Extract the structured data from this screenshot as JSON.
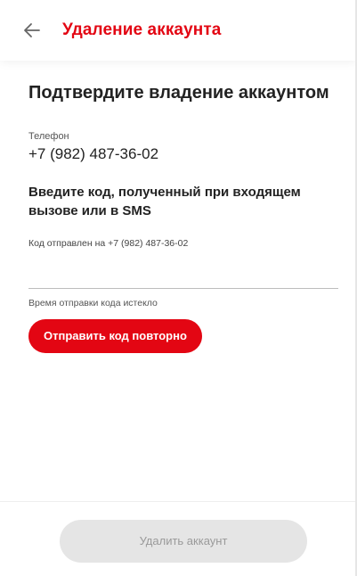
{
  "header": {
    "back_icon": "arrow-left-icon",
    "title": "Удаление аккаунта"
  },
  "main": {
    "title": "Подтвердите владение аккаунтом",
    "phone_label": "Телефон",
    "phone_value": "+7 (982) 487-36-02",
    "instruction": "Введите код, полученный при входящем вызове или в SMS",
    "sent_note": "Код отправлен на +7 (982) 487-36-02",
    "code_value": "",
    "expired_note": "Время отправки кода истекло",
    "resend_label": "Отправить код повторно"
  },
  "footer": {
    "delete_label": "Удалить аккаунт",
    "delete_disabled": true
  },
  "colors": {
    "accent": "#e30613",
    "disabled_bg": "#e5e5e5",
    "disabled_text": "#9a9a9a"
  }
}
